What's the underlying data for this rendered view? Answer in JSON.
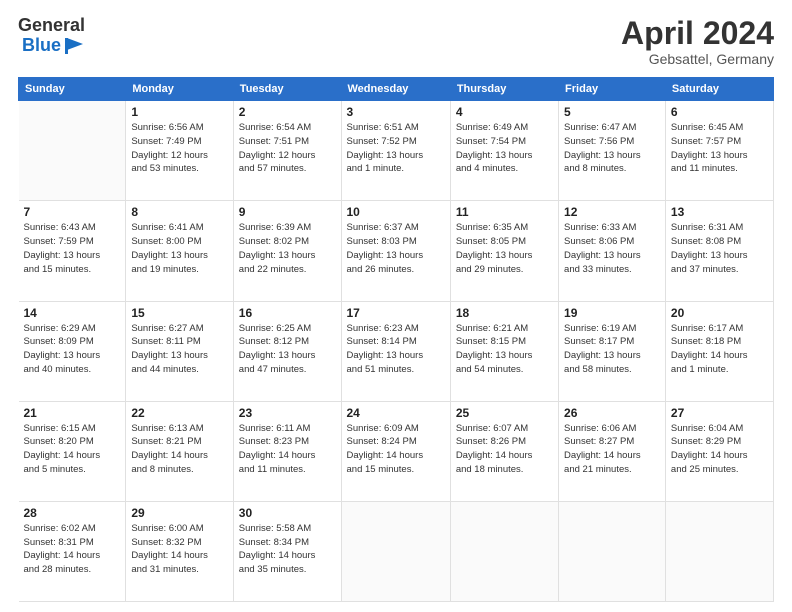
{
  "header": {
    "logo_general": "General",
    "logo_blue": "Blue",
    "month_title": "April 2024",
    "location": "Gebsattel, Germany"
  },
  "days_of_week": [
    "Sunday",
    "Monday",
    "Tuesday",
    "Wednesday",
    "Thursday",
    "Friday",
    "Saturday"
  ],
  "weeks": [
    [
      {
        "day": "",
        "info": ""
      },
      {
        "day": "1",
        "info": "Sunrise: 6:56 AM\nSunset: 7:49 PM\nDaylight: 12 hours\nand 53 minutes."
      },
      {
        "day": "2",
        "info": "Sunrise: 6:54 AM\nSunset: 7:51 PM\nDaylight: 12 hours\nand 57 minutes."
      },
      {
        "day": "3",
        "info": "Sunrise: 6:51 AM\nSunset: 7:52 PM\nDaylight: 13 hours\nand 1 minute."
      },
      {
        "day": "4",
        "info": "Sunrise: 6:49 AM\nSunset: 7:54 PM\nDaylight: 13 hours\nand 4 minutes."
      },
      {
        "day": "5",
        "info": "Sunrise: 6:47 AM\nSunset: 7:56 PM\nDaylight: 13 hours\nand 8 minutes."
      },
      {
        "day": "6",
        "info": "Sunrise: 6:45 AM\nSunset: 7:57 PM\nDaylight: 13 hours\nand 11 minutes."
      }
    ],
    [
      {
        "day": "7",
        "info": "Sunrise: 6:43 AM\nSunset: 7:59 PM\nDaylight: 13 hours\nand 15 minutes."
      },
      {
        "day": "8",
        "info": "Sunrise: 6:41 AM\nSunset: 8:00 PM\nDaylight: 13 hours\nand 19 minutes."
      },
      {
        "day": "9",
        "info": "Sunrise: 6:39 AM\nSunset: 8:02 PM\nDaylight: 13 hours\nand 22 minutes."
      },
      {
        "day": "10",
        "info": "Sunrise: 6:37 AM\nSunset: 8:03 PM\nDaylight: 13 hours\nand 26 minutes."
      },
      {
        "day": "11",
        "info": "Sunrise: 6:35 AM\nSunset: 8:05 PM\nDaylight: 13 hours\nand 29 minutes."
      },
      {
        "day": "12",
        "info": "Sunrise: 6:33 AM\nSunset: 8:06 PM\nDaylight: 13 hours\nand 33 minutes."
      },
      {
        "day": "13",
        "info": "Sunrise: 6:31 AM\nSunset: 8:08 PM\nDaylight: 13 hours\nand 37 minutes."
      }
    ],
    [
      {
        "day": "14",
        "info": "Sunrise: 6:29 AM\nSunset: 8:09 PM\nDaylight: 13 hours\nand 40 minutes."
      },
      {
        "day": "15",
        "info": "Sunrise: 6:27 AM\nSunset: 8:11 PM\nDaylight: 13 hours\nand 44 minutes."
      },
      {
        "day": "16",
        "info": "Sunrise: 6:25 AM\nSunset: 8:12 PM\nDaylight: 13 hours\nand 47 minutes."
      },
      {
        "day": "17",
        "info": "Sunrise: 6:23 AM\nSunset: 8:14 PM\nDaylight: 13 hours\nand 51 minutes."
      },
      {
        "day": "18",
        "info": "Sunrise: 6:21 AM\nSunset: 8:15 PM\nDaylight: 13 hours\nand 54 minutes."
      },
      {
        "day": "19",
        "info": "Sunrise: 6:19 AM\nSunset: 8:17 PM\nDaylight: 13 hours\nand 58 minutes."
      },
      {
        "day": "20",
        "info": "Sunrise: 6:17 AM\nSunset: 8:18 PM\nDaylight: 14 hours\nand 1 minute."
      }
    ],
    [
      {
        "day": "21",
        "info": "Sunrise: 6:15 AM\nSunset: 8:20 PM\nDaylight: 14 hours\nand 5 minutes."
      },
      {
        "day": "22",
        "info": "Sunrise: 6:13 AM\nSunset: 8:21 PM\nDaylight: 14 hours\nand 8 minutes."
      },
      {
        "day": "23",
        "info": "Sunrise: 6:11 AM\nSunset: 8:23 PM\nDaylight: 14 hours\nand 11 minutes."
      },
      {
        "day": "24",
        "info": "Sunrise: 6:09 AM\nSunset: 8:24 PM\nDaylight: 14 hours\nand 15 minutes."
      },
      {
        "day": "25",
        "info": "Sunrise: 6:07 AM\nSunset: 8:26 PM\nDaylight: 14 hours\nand 18 minutes."
      },
      {
        "day": "26",
        "info": "Sunrise: 6:06 AM\nSunset: 8:27 PM\nDaylight: 14 hours\nand 21 minutes."
      },
      {
        "day": "27",
        "info": "Sunrise: 6:04 AM\nSunset: 8:29 PM\nDaylight: 14 hours\nand 25 minutes."
      }
    ],
    [
      {
        "day": "28",
        "info": "Sunrise: 6:02 AM\nSunset: 8:31 PM\nDaylight: 14 hours\nand 28 minutes."
      },
      {
        "day": "29",
        "info": "Sunrise: 6:00 AM\nSunset: 8:32 PM\nDaylight: 14 hours\nand 31 minutes."
      },
      {
        "day": "30",
        "info": "Sunrise: 5:58 AM\nSunset: 8:34 PM\nDaylight: 14 hours\nand 35 minutes."
      },
      {
        "day": "",
        "info": ""
      },
      {
        "day": "",
        "info": ""
      },
      {
        "day": "",
        "info": ""
      },
      {
        "day": "",
        "info": ""
      }
    ]
  ]
}
